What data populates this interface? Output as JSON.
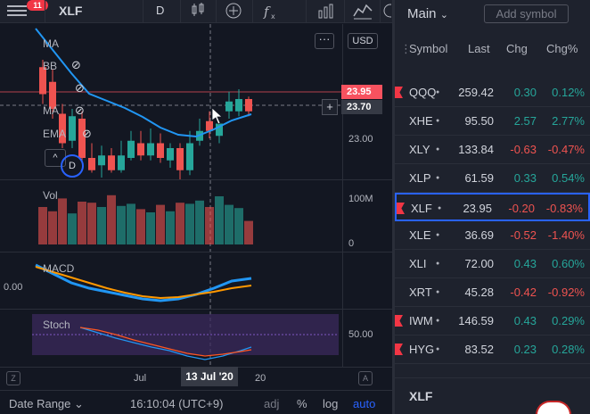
{
  "toolbar": {
    "notifications": "11",
    "symbol": "XLF",
    "interval": "D",
    "icons": [
      "candles-icon",
      "add-compare-icon",
      "indicators-icon",
      "bar-chart-icon",
      "templates-icon"
    ]
  },
  "chart": {
    "currency": "USD",
    "menu_label": "···",
    "current_price": "23.95",
    "crosshair_price": "23.70",
    "price_tick": "23.00",
    "crosshair_plus": "+",
    "legend": [
      "MA",
      "BB",
      "",
      "MA",
      "EMA"
    ],
    "collapse_label": "^",
    "volume": {
      "label": "Vol",
      "ticks": [
        "100M",
        "0"
      ]
    },
    "macd": {
      "label": "MACD",
      "tick": "0.00"
    },
    "stoch": {
      "label": "Stoch",
      "tick": "50.00"
    },
    "time_ticks": [
      "Jul",
      "20"
    ],
    "crosshair_date": "13 Jul '20",
    "candles": [
      {
        "o": 24.85,
        "c": 24.3,
        "h": 25.0,
        "l": 24.1
      },
      {
        "o": 24.55,
        "c": 24.0,
        "h": 24.8,
        "l": 23.8
      },
      {
        "o": 23.9,
        "c": 23.3,
        "h": 24.1,
        "l": 23.2
      },
      {
        "o": 23.35,
        "c": 23.85,
        "h": 24.0,
        "l": 23.2
      },
      {
        "o": 23.8,
        "c": 23.0,
        "h": 23.95,
        "l": 22.9
      },
      {
        "o": 23.0,
        "c": 22.75,
        "h": 23.3,
        "l": 22.7
      },
      {
        "o": 22.85,
        "c": 23.05,
        "h": 23.25,
        "l": 22.6
      },
      {
        "o": 23.05,
        "c": 22.75,
        "h": 23.2,
        "l": 22.7
      },
      {
        "o": 22.75,
        "c": 23.05,
        "h": 23.35,
        "l": 22.7
      },
      {
        "o": 23.0,
        "c": 23.35,
        "h": 23.55,
        "l": 22.95
      },
      {
        "o": 23.3,
        "c": 23.05,
        "h": 23.55,
        "l": 22.95
      },
      {
        "o": 23.05,
        "c": 23.3,
        "h": 23.6,
        "l": 22.95
      },
      {
        "o": 23.3,
        "c": 23.0,
        "h": 23.5,
        "l": 22.9
      },
      {
        "o": 22.95,
        "c": 23.2,
        "h": 23.3,
        "l": 22.8
      },
      {
        "o": 23.2,
        "c": 22.75,
        "h": 23.3,
        "l": 22.55
      },
      {
        "o": 22.75,
        "c": 23.3,
        "h": 23.55,
        "l": 22.65
      },
      {
        "o": 23.35,
        "c": 23.55,
        "h": 23.8,
        "l": 23.25
      },
      {
        "o": 23.75,
        "c": 23.55,
        "h": 23.95,
        "l": 23.4
      },
      {
        "o": 23.45,
        "c": 23.7,
        "h": 23.75,
        "l": 23.3
      },
      {
        "o": 23.95,
        "c": 24.15,
        "h": 24.35,
        "l": 23.8
      },
      {
        "o": 23.95,
        "c": 24.2,
        "h": 24.4,
        "l": 23.85
      },
      {
        "o": 24.2,
        "c": 23.95,
        "h": 24.25,
        "l": 23.85
      }
    ],
    "volumes": [
      70,
      62,
      86,
      58,
      80,
      78,
      70,
      92,
      72,
      76,
      66,
      60,
      74,
      62,
      78,
      76,
      82,
      70,
      90,
      74,
      68,
      44
    ]
  },
  "statusbar": {
    "date_range": "Date Range",
    "time": "16:10:04 (UTC+9)",
    "adj": "adj",
    "pct": "%",
    "log": "log",
    "auto": "auto",
    "z_left": "Z",
    "z_right": "A"
  },
  "watchlist": {
    "title": "Main",
    "add_symbol": "Add symbol",
    "columns": [
      "Symbol",
      "Last",
      "Chg",
      "Chg%"
    ],
    "rows": [
      {
        "sym": "QQQ",
        "last": "259.42",
        "chg": "0.30",
        "chgp": "0.12%",
        "dir": "pos",
        "flag": true
      },
      {
        "sym": "XHE",
        "last": "95.50",
        "chg": "2.57",
        "chgp": "2.77%",
        "dir": "pos",
        "flag": false
      },
      {
        "sym": "XLY",
        "last": "133.84",
        "chg": "-0.63",
        "chgp": "-0.47%",
        "dir": "neg",
        "flag": false
      },
      {
        "sym": "XLP",
        "last": "61.59",
        "chg": "0.33",
        "chgp": "0.54%",
        "dir": "pos",
        "flag": false
      },
      {
        "sym": "XLF",
        "last": "23.95",
        "chg": "-0.20",
        "chgp": "-0.83%",
        "dir": "neg",
        "flag": true,
        "selected": true
      },
      {
        "sym": "XLE",
        "last": "36.69",
        "chg": "-0.52",
        "chgp": "-1.40%",
        "dir": "neg",
        "flag": false
      },
      {
        "sym": "XLI",
        "last": "72.00",
        "chg": "0.43",
        "chgp": "0.60%",
        "dir": "pos",
        "flag": false
      },
      {
        "sym": "XRT",
        "last": "45.28",
        "chg": "-0.42",
        "chgp": "-0.92%",
        "dir": "neg",
        "flag": false
      },
      {
        "sym": "IWM",
        "last": "146.59",
        "chg": "0.43",
        "chgp": "0.29%",
        "dir": "pos",
        "flag": true
      },
      {
        "sym": "HYG",
        "last": "83.52",
        "chg": "0.23",
        "chgp": "0.28%",
        "dir": "pos",
        "flag": true
      }
    ],
    "bottom_symbol": "XLF"
  }
}
